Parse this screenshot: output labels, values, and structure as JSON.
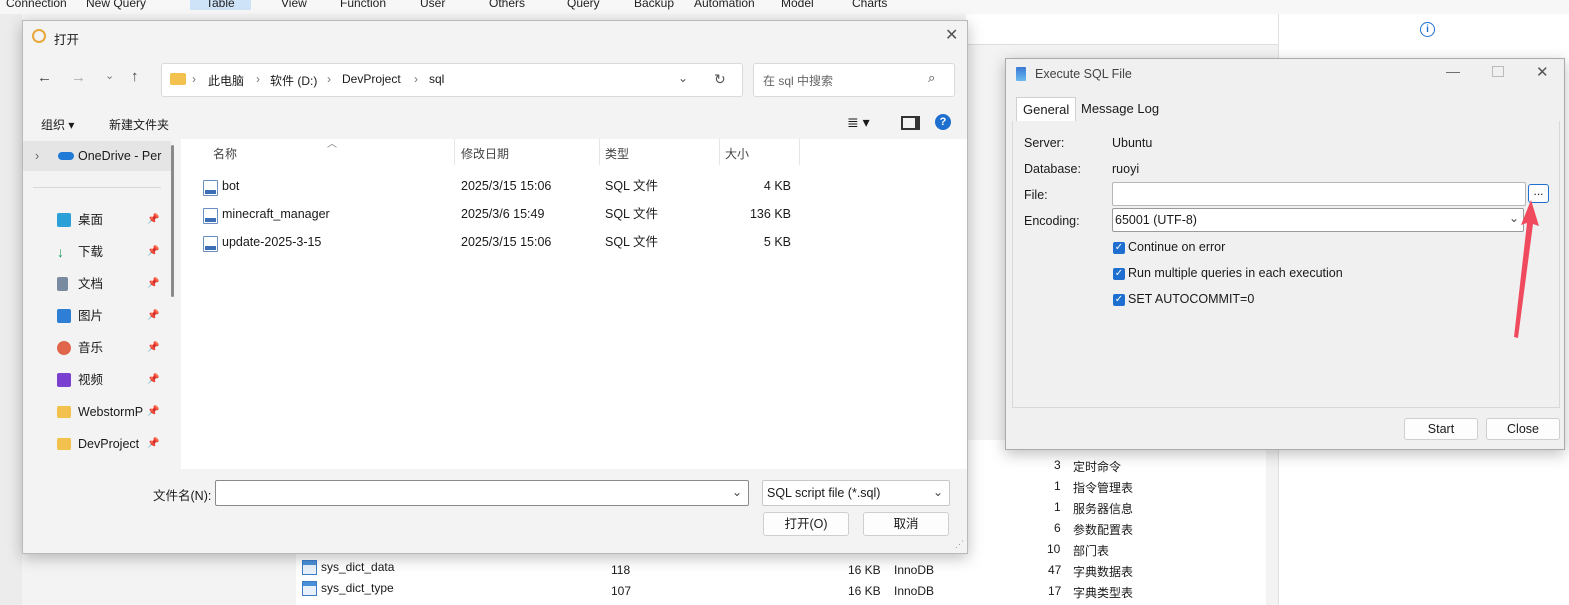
{
  "menubar": {
    "items": [
      "Connection",
      "New Query",
      "Table",
      "View",
      "Function",
      "User",
      "Others",
      "Query",
      "Backup",
      "Automation",
      "Model",
      "Charts"
    ],
    "active": "Table"
  },
  "background_table": {
    "rows": [
      {
        "name": "sys_dict_data",
        "rows": "118",
        "size": "16 KB",
        "engine": "InnoDB",
        "count": "47",
        "comment": "字典数据表"
      },
      {
        "name": "sys_dict_type",
        "rows": "107",
        "size": "16 KB",
        "engine": "InnoDB",
        "count": "17",
        "comment": "字典类型表"
      }
    ],
    "side_rows": [
      {
        "count": "3",
        "comment": "定时命令"
      },
      {
        "count": "1",
        "comment": "指令管理表"
      },
      {
        "count": "1",
        "comment": "服务器信息"
      },
      {
        "count": "6",
        "comment": "参数配置表"
      },
      {
        "count": "10",
        "comment": "部门表"
      }
    ]
  },
  "open_dialog": {
    "title": "打开",
    "breadcrumb": [
      "此电脑",
      "软件 (D:)",
      "DevProject",
      "sql"
    ],
    "search_placeholder": "在 sql 中搜索",
    "organize_label": "组织",
    "new_folder_label": "新建文件夹",
    "nav": [
      {
        "label": "OneDrive - Per",
        "icon": "cloud-icon",
        "color": "#1f7ad8"
      },
      {
        "label": "桌面",
        "icon": "desktop-icon",
        "color": "#2aa0d8"
      },
      {
        "label": "下载",
        "icon": "download-icon",
        "color": "#1a9c5b"
      },
      {
        "label": "文档",
        "icon": "document-icon",
        "color": "#7a8aa0"
      },
      {
        "label": "图片",
        "icon": "pictures-icon",
        "color": "#2f7fd6"
      },
      {
        "label": "音乐",
        "icon": "music-icon",
        "color": "#e0664b"
      },
      {
        "label": "视频",
        "icon": "video-icon",
        "color": "#7a3fd0"
      },
      {
        "label": "WebstormP",
        "icon": "folder-icon",
        "color": "#f2c14e"
      },
      {
        "label": "DevProject",
        "icon": "folder-icon",
        "color": "#f2c14e"
      }
    ],
    "columns": [
      "名称",
      "修改日期",
      "类型",
      "大小"
    ],
    "files": [
      {
        "name": "bot",
        "date": "2025/3/15 15:06",
        "type": "SQL 文件",
        "size": "4 KB"
      },
      {
        "name": "minecraft_manager",
        "date": "2025/3/6 15:49",
        "type": "SQL 文件",
        "size": "136 KB"
      },
      {
        "name": "update-2025-3-15",
        "date": "2025/3/15 15:06",
        "type": "SQL 文件",
        "size": "5 KB"
      }
    ],
    "filename_label": "文件名(N):",
    "filename_value": "",
    "filter_value": "SQL script file (*.sql)",
    "open_button": "打开(O)",
    "cancel_button": "取消"
  },
  "execute_dialog": {
    "title": "Execute SQL File",
    "tabs": [
      "General",
      "Message Log"
    ],
    "server_label": "Server:",
    "server_value": "Ubuntu",
    "database_label": "Database:",
    "database_value": "ruoyi",
    "file_label": "File:",
    "file_value": "",
    "browse_button": "...",
    "encoding_label": "Encoding:",
    "encoding_value": "65001 (UTF-8)",
    "options": [
      "Continue on error",
      "Run multiple queries in each execution",
      "SET AUTOCOMMIT=0"
    ],
    "start_button": "Start",
    "close_button": "Close"
  },
  "colors": {
    "accent": "#1e6fd0",
    "annotation_arrow": "#f04a5e"
  }
}
